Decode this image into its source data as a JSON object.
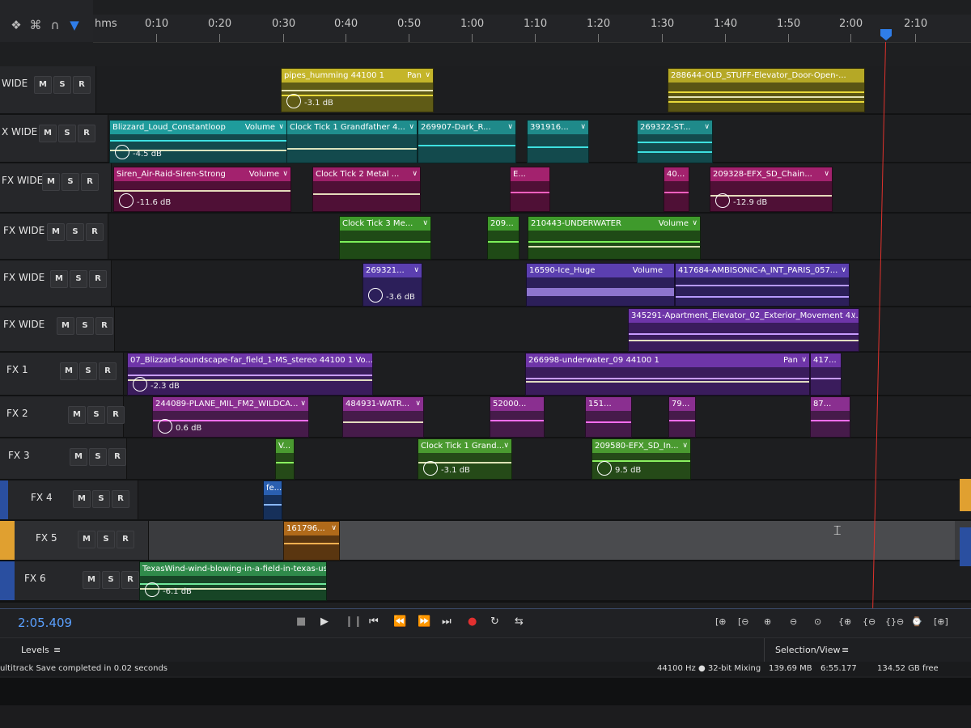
{
  "toolbar": {
    "tools": [
      "move-tool",
      "time-selection-tool",
      "slip-tool",
      "razor-tool",
      "snap-magnet",
      "playhead-marker"
    ]
  },
  "ruler": {
    "unit": "hms",
    "ticks": [
      "0:10",
      "0:20",
      "0:30",
      "0:40",
      "0:50",
      "1:00",
      "1:10",
      "1:20",
      "1:30",
      "1:40",
      "1:50",
      "2:00",
      "2:10"
    ]
  },
  "track_buttons": {
    "mute": "M",
    "solo": "S",
    "record": "R"
  },
  "tracks": [
    {
      "name": "WIDE",
      "clips": [
        {
          "name": "pipes_humming 44100 1",
          "param": "Pan",
          "gain": "-3.1 dB",
          "color": "#c4b52a"
        },
        {
          "name": "288644-OLD_STUFF-Elevator_Door-Open-...",
          "param": "",
          "gain": "",
          "color": "#b5a826"
        }
      ]
    },
    {
      "name": "X WIDE",
      "clips": [
        {
          "name": "Blizzard_Loud_Constantloop",
          "param": "Volume",
          "gain": "-4.5 dB",
          "color": "#1f9c9c"
        },
        {
          "name": "Clock Tick 1 Grandfather 4...",
          "param": "",
          "gain": "",
          "color": "#1f8e8e"
        },
        {
          "name": "269907-Dark_R...",
          "param": "",
          "gain": "",
          "color": "#1f8a8a"
        },
        {
          "name": "391916...",
          "param": "",
          "gain": "",
          "color": "#1f8a8a"
        },
        {
          "name": "269322-ST...",
          "param": "",
          "gain": "",
          "color": "#1f8a8a"
        }
      ]
    },
    {
      "name": "FX WIDE",
      "clips": [
        {
          "name": "Siren_Air-Raid-Siren-Strong",
          "param": "Volume",
          "gain": "-11.6 dB",
          "color": "#a3226e"
        },
        {
          "name": "Clock Tick 2 Metal ...",
          "param": "",
          "gain": "",
          "color": "#9c2068"
        },
        {
          "name": "E...",
          "param": "",
          "gain": "",
          "color": "#a3226e"
        },
        {
          "name": "40...",
          "param": "",
          "gain": "",
          "color": "#a3226e"
        },
        {
          "name": "209328-EFX_SD_Chain...",
          "param": "",
          "gain": "-12.9 dB",
          "color": "#a3226e"
        }
      ]
    },
    {
      "name": "FX WIDE",
      "clips": [
        {
          "name": "Clock Tick 3 Me...",
          "param": "",
          "gain": "",
          "color": "#3f9a2c"
        },
        {
          "name": "209...",
          "param": "",
          "gain": "",
          "color": "#3f9a2c"
        },
        {
          "name": "210443-UNDERWATER",
          "param": "Volume",
          "gain": "",
          "color": "#3f9a2c"
        }
      ]
    },
    {
      "name": "FX WIDE",
      "clips": [
        {
          "name": "269321...",
          "param": "",
          "gain": "-3.6 dB",
          "color": "#5b3fb0"
        },
        {
          "name": "16590-Ice_Huge",
          "param": "Volume",
          "gain": "",
          "color": "#5b3fb0"
        },
        {
          "name": "417684-AMBISONIC-A_INT_PARIS_057...",
          "param": "",
          "gain": "",
          "color": "#5b3fb0"
        }
      ]
    },
    {
      "name": "FX WIDE",
      "clips": [
        {
          "name": "345291-Apartment_Elevator_02_Exterior_Movement 4...",
          "param": "",
          "gain": "",
          "color": "#6e35a8"
        }
      ]
    },
    {
      "name": "FX 1",
      "clips": [
        {
          "name": "07_Blizzard-soundscape-far_field_1-MS_stereo 44100 1 Vo...",
          "param": "",
          "gain": "-2.3 dB",
          "color": "#6e35a8"
        },
        {
          "name": "266998-underwater_09 44100 1",
          "param": "Pan",
          "gain": "",
          "color": "#6e35a8"
        },
        {
          "name": "417...",
          "param": "",
          "gain": "",
          "color": "#6e35a8"
        }
      ]
    },
    {
      "name": "FX 2",
      "clips": [
        {
          "name": "244089-PLANE_MIL_FM2_WILDCA...",
          "param": "",
          "gain": "0.6 dB",
          "color": "#8a2f90"
        },
        {
          "name": "484931-WATR...",
          "param": "",
          "gain": "",
          "color": "#8a2f90"
        },
        {
          "name": "52000...",
          "param": "",
          "gain": "",
          "color": "#8a2f90"
        },
        {
          "name": "151...",
          "param": "",
          "gain": "",
          "color": "#8a2f90"
        },
        {
          "name": "79...",
          "param": "",
          "gain": "",
          "color": "#8a2f90"
        },
        {
          "name": "87...",
          "param": "",
          "gain": "",
          "color": "#8a2f90"
        }
      ]
    },
    {
      "name": "FX 3",
      "clips": [
        {
          "name": "V...",
          "param": "",
          "gain": "",
          "color": "#4a9a30"
        },
        {
          "name": "Clock Tick 1 Grand...",
          "param": "",
          "gain": "-3.1 dB",
          "color": "#4a9a30"
        },
        {
          "name": "209580-EFX_SD_In...",
          "param": "",
          "gain": "9.5 dB",
          "color": "#4a9a30"
        }
      ]
    },
    {
      "name": "FX 4",
      "clips": [
        {
          "name": "fe...",
          "param": "",
          "gain": "",
          "color": "#2a5fb0"
        }
      ]
    },
    {
      "name": "FX 5",
      "clips": [
        {
          "name": "161796...",
          "param": "",
          "gain": "",
          "color": "#b06a1a"
        }
      ]
    },
    {
      "name": "FX 6",
      "clips": [
        {
          "name": "TexasWind-wind-blowing-in-a-field-in-texas-us...",
          "param": "",
          "gain": "-6.1 dB",
          "color": "#2f8a4a"
        }
      ]
    }
  ],
  "transport": {
    "timecode": "2:05.409",
    "controls": [
      "stop",
      "play",
      "pause",
      "go-to-start",
      "rewind",
      "fast-forward",
      "go-to-end",
      "record",
      "loop",
      "skip-selection"
    ],
    "zoom_controls": [
      "zoom-in-amplitude",
      "zoom-out-amplitude",
      "zoom-in-time",
      "zoom-out-time",
      "zoom-full",
      "zoom-selection-in",
      "zoom-selection-out",
      "zoom-out-full",
      "zoom-to-playhead",
      "zoom-reset"
    ]
  },
  "panels": {
    "left_title": "Levels",
    "right_title": "Selection/View"
  },
  "status": {
    "message": "ultitrack Save completed in 0.02 seconds",
    "sample_rate": "44100 Hz ● 32-bit Mixing",
    "memory": "139.69 MB",
    "duration": "6:55.177",
    "free_space": "134.52 GB free"
  }
}
